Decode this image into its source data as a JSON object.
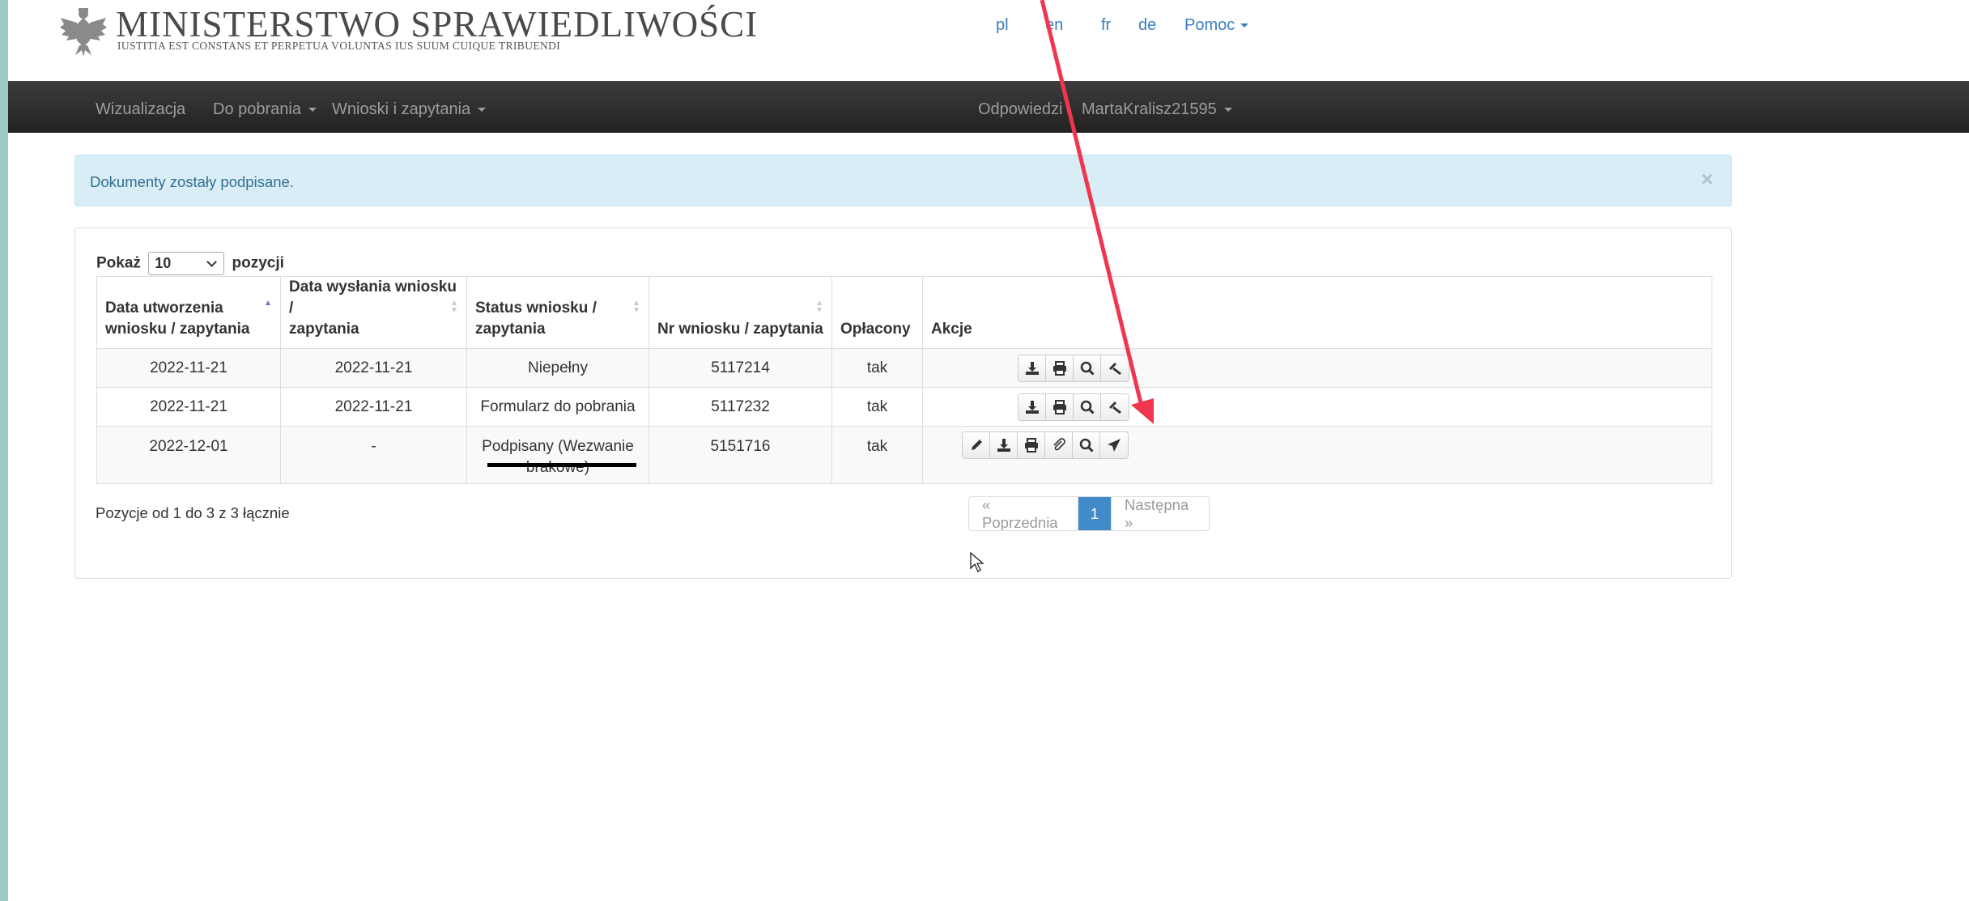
{
  "header": {
    "title": "MINISTERSTWO SPRAWIEDLIWOŚCI",
    "motto": "IUSTITIA EST CONSTANS ET PERPETUA VOLUNTAS IUS SUUM CUIQUE TRIBUENDI",
    "languages": [
      "pl",
      "en",
      "fr",
      "de"
    ],
    "help_label": "Pomoc",
    "emblem_icon": "eagle-emblem-icon"
  },
  "navbar": {
    "items": [
      {
        "label": "Wizualizacja"
      },
      {
        "label": "Do pobrania",
        "dropdown": true
      },
      {
        "label": "Wnioski i zapytania",
        "dropdown": true
      }
    ],
    "right": [
      {
        "label": "Odpowiedzi"
      },
      {
        "label": "MartaKralisz21595",
        "dropdown": true
      }
    ]
  },
  "alert": {
    "text": "Dokumenty zostały podpisane.",
    "close": "×"
  },
  "table": {
    "show_prefix": "Pokaż",
    "page_size": "10",
    "show_suffix": "pozycji",
    "columns": [
      {
        "line1": "Data utworzenia",
        "line2": "wniosku / zapytania"
      },
      {
        "line1": "Data wysłania wniosku /",
        "line2": "zapytania"
      },
      {
        "line1": "Status wniosku /",
        "line2": "zapytania"
      },
      {
        "line1": "",
        "line2": "Nr wniosku / zapytania"
      },
      {
        "line1": "",
        "line2": "Opłacony"
      },
      {
        "line1": "",
        "line2": "Akcje"
      }
    ],
    "rows": [
      {
        "created": "2022-11-21",
        "sent": "2022-11-21",
        "status": "Niepełny",
        "status2": "",
        "number": "5117214",
        "paid": "tak",
        "actions": [
          "download-icon",
          "print-icon",
          "search-icon",
          "gavel-icon"
        ]
      },
      {
        "created": "2022-11-21",
        "sent": "2022-11-21",
        "status": "Formularz do pobrania",
        "status2": "",
        "number": "5117232",
        "paid": "tak",
        "actions": [
          "download-icon",
          "print-icon",
          "search-icon",
          "gavel-icon"
        ]
      },
      {
        "created": "2022-12-01",
        "sent": "-",
        "status": "Podpisany (Wezwanie",
        "status2": "brakowe)",
        "number": "5151716",
        "paid": "tak",
        "actions": [
          "pencil-icon",
          "download-icon",
          "print-icon",
          "paperclip-icon",
          "search-icon",
          "send-icon"
        ]
      }
    ]
  },
  "footer": {
    "info": "Pozycje od 1 do 3 z 3 łącznie",
    "prev": "« Poprzednia",
    "current": "1",
    "next": "Następna »"
  },
  "annotation": {
    "arrow_color": "#f0364f"
  }
}
